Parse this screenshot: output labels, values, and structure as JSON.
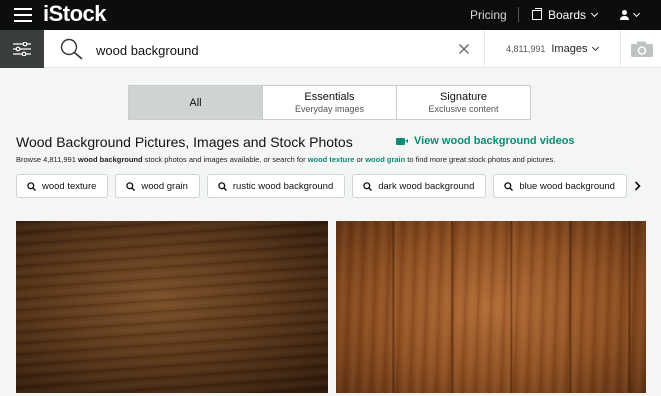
{
  "header": {
    "logo": "iStock",
    "pricing": "Pricing",
    "boards": "Boards"
  },
  "search": {
    "query": "wood background",
    "count": "4,811,991",
    "media_type": "Images"
  },
  "tabs": [
    {
      "label": "All",
      "sub": ""
    },
    {
      "label": "Essentials",
      "sub": "Everyday images"
    },
    {
      "label": "Signature",
      "sub": "Exclusive content"
    }
  ],
  "page": {
    "title": "Wood Background Pictures, Images and Stock Photos",
    "video_link": "View wood background videos",
    "desc": {
      "p1": "Browse 4,811,991 ",
      "b1": "wood background",
      "p2": " stock photos and images available, or search for ",
      "l1": "wood texture",
      "p3": " or ",
      "l2": "wood grain",
      "p4": " to find more great stock photos and pictures."
    }
  },
  "related": [
    "wood texture",
    "wood grain",
    "rustic wood background",
    "dark wood background",
    "blue wood background"
  ],
  "colors": {
    "topbar": "#0c0d0d",
    "accent": "#0c8c74",
    "filter_button": "#3b3e3e",
    "tab_active": "#ced4d4"
  },
  "icons": [
    "menu-icon",
    "boards-icon",
    "user-icon",
    "filter-icon",
    "search-icon",
    "clear-icon",
    "chevron-down-icon",
    "camera-icon",
    "video-icon",
    "chevron-right-icon"
  ]
}
